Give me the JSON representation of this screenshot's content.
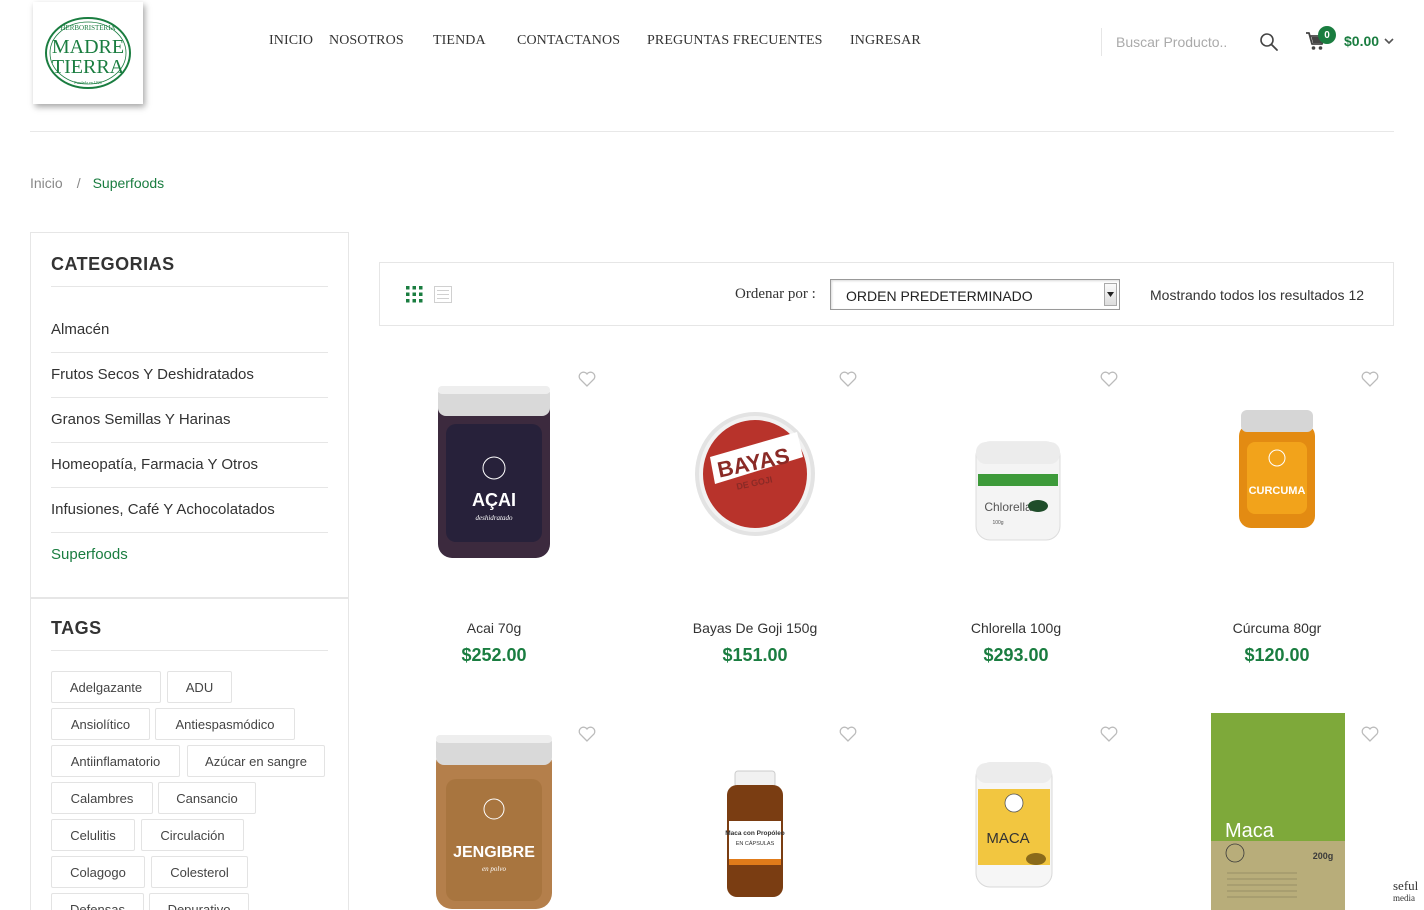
{
  "brand": {
    "logo_top": "HERBORISTERIA",
    "logo_line1": "MADRE",
    "logo_line2": "TIERRA",
    "logo_bottom": "Fundada en 1920"
  },
  "nav": {
    "items": [
      "INICIO",
      "NOSOTROS",
      "TIENDA",
      "CONTACTANOS",
      "PREGUNTAS FRECUENTES",
      "INGRESAR"
    ]
  },
  "search": {
    "placeholder": "Buscar Producto.."
  },
  "cart": {
    "count": "0",
    "total": "$0.00"
  },
  "breadcrumb": {
    "home": "Inicio",
    "separator": "/",
    "current": "Superfoods"
  },
  "sidebar": {
    "categories_title": "CATEGORIAS",
    "categories": [
      "Almacén",
      "Frutos Secos Y Deshidratados",
      "Granos Semillas Y Harinas",
      "Homeopatía, Farmacia Y Otros",
      "Infusiones, Café Y Achocolatados",
      "Superfoods"
    ],
    "active_category": "Superfoods",
    "tags_title": "TAGS",
    "tags": [
      "Adelgazante",
      "ADU",
      "Ansiolítico",
      "Antiespasmódico",
      "Antiinflamatorio",
      "Azúcar en sangre",
      "Calambres",
      "Cansancio",
      "Celulitis",
      "Circulación",
      "Colagogo",
      "Colesterol",
      "Defensas",
      "Depurativo"
    ]
  },
  "toolbar": {
    "sort_label": "Ordenar por :",
    "sort_value": "ORDEN PREDETERMINADO",
    "results_text": "Mostrando todos los resultados 12"
  },
  "products": [
    {
      "name": "Acai 70g",
      "price": "$252.00",
      "label": "AÇAI",
      "sublabel": "deshidratado"
    },
    {
      "name": "Bayas De Goji 150g",
      "price": "$151.00",
      "label": "BAYAS",
      "sublabel": "DE GOJI"
    },
    {
      "name": "Chlorella 100g",
      "price": "$293.00",
      "label": "Chlorella",
      "sublabel": "100g"
    },
    {
      "name": "Cúrcuma 80gr",
      "price": "$120.00",
      "label": "CURCUMA",
      "sublabel": ""
    },
    {
      "name": "",
      "price": "",
      "label": "JENGIBRE",
      "sublabel": "en polvo"
    },
    {
      "name": "",
      "price": "",
      "label": "Maca con Propóleo",
      "sublabel": "EN CÁPSULAS"
    },
    {
      "name": "",
      "price": "",
      "label": "MACA",
      "sublabel": ""
    },
    {
      "name": "",
      "price": "",
      "label": "Maca",
      "sublabel": "200g"
    }
  ],
  "watermark": {
    "line1": "seful",
    "line2": "media"
  },
  "colors": {
    "accent": "#1a7d40",
    "border": "#e6e6e6"
  }
}
